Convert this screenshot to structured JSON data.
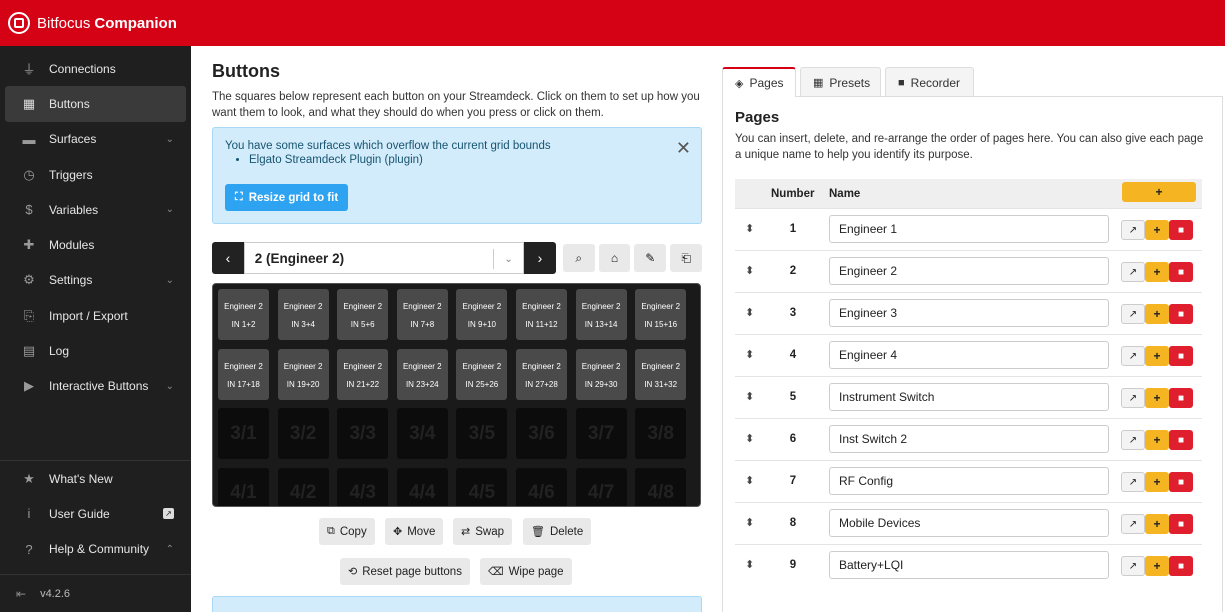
{
  "app": {
    "brand_plain": "Bitfocus",
    "brand_bold": "Companion",
    "version": "v4.2.6"
  },
  "colors": {
    "brand_red": "#d50215",
    "sidebar_bg": "#1f1f1f",
    "accent_blue": "#2ea3f2",
    "add_yellow": "#f5b523",
    "delete_red": "#e01f2e"
  },
  "sidebar": {
    "items": [
      {
        "label": "Connections",
        "icon": "plug-icon"
      },
      {
        "label": "Buttons",
        "icon": "grid-icon"
      },
      {
        "label": "Surfaces",
        "icon": "gamepad-icon"
      },
      {
        "label": "Triggers",
        "icon": "clock-icon"
      },
      {
        "label": "Variables",
        "icon": "dollar-icon"
      },
      {
        "label": "Modules",
        "icon": "puzzle-icon"
      },
      {
        "label": "Settings",
        "icon": "gear-icon"
      },
      {
        "label": "Import / Export",
        "icon": "file-import-icon"
      },
      {
        "label": "Log",
        "icon": "clipboard-icon"
      },
      {
        "label": "Interactive Buttons",
        "icon": "play-square-icon"
      }
    ],
    "bottom": [
      {
        "label": "What's New",
        "icon": "star-icon"
      },
      {
        "label": "User Guide",
        "icon": "info-icon"
      },
      {
        "label": "Help & Community",
        "icon": "question-icon"
      }
    ]
  },
  "buttons_page": {
    "title": "Buttons",
    "lead": "The squares below represent each button on your Streamdeck. Click on them to set up how you want them to look, and what they should do when you press or click on them.",
    "alert_text": "You have some surfaces which overflow the current grid bounds",
    "alert_item": "Elgato Streamdeck Plugin (plugin)",
    "resize_label": "Resize grid to fit",
    "page_select": "2 (Engineer 2)",
    "used_buttons": [
      {
        "line1": "Engineer 2",
        "line2": "IN 1+2"
      },
      {
        "line1": "Engineer 2",
        "line2": "IN 3+4"
      },
      {
        "line1": "Engineer 2",
        "line2": "IN 5+6"
      },
      {
        "line1": "Engineer 2",
        "line2": "IN 7+8"
      },
      {
        "line1": "Engineer 2",
        "line2": "IN 9+10"
      },
      {
        "line1": "Engineer 2",
        "line2": "IN 11+12"
      },
      {
        "line1": "Engineer 2",
        "line2": "IN 13+14"
      },
      {
        "line1": "Engineer 2",
        "line2": "IN 15+16"
      },
      {
        "line1": "Engineer 2",
        "line2": "IN 17+18"
      },
      {
        "line1": "Engineer 2",
        "line2": "IN 19+20"
      },
      {
        "line1": "Engineer 2",
        "line2": "IN 21+22"
      },
      {
        "line1": "Engineer 2",
        "line2": "IN 23+24"
      },
      {
        "line1": "Engineer 2",
        "line2": "IN 25+26"
      },
      {
        "line1": "Engineer 2",
        "line2": "IN 27+28"
      },
      {
        "line1": "Engineer 2",
        "line2": "IN 29+30"
      },
      {
        "line1": "Engineer 2",
        "line2": "IN 31+32"
      }
    ],
    "empty_buttons": [
      "3/1",
      "3/2",
      "3/3",
      "3/4",
      "3/5",
      "3/6",
      "3/7",
      "3/8",
      "4/1",
      "4/2",
      "4/3",
      "4/4",
      "4/5",
      "4/6",
      "4/7",
      "4/8"
    ],
    "actions": {
      "copy": "Copy",
      "move": "Move",
      "swap": "Swap",
      "delete": "Delete",
      "reset": "Reset page buttons",
      "wipe": "Wipe page"
    }
  },
  "right_panel": {
    "tabs": [
      "Pages",
      "Presets",
      "Recorder"
    ],
    "title": "Pages",
    "desc": "You can insert, delete, and re-arrange the order of pages here. You can also give each page a unique name to help you identify its purpose.",
    "col_number": "Number",
    "col_name": "Name",
    "add_label": "+",
    "pages": [
      {
        "number": "1",
        "name": "Engineer 1"
      },
      {
        "number": "2",
        "name": "Engineer 2"
      },
      {
        "number": "3",
        "name": "Engineer 3"
      },
      {
        "number": "4",
        "name": "Engineer 4"
      },
      {
        "number": "5",
        "name": "Instrument Switch"
      },
      {
        "number": "6",
        "name": "Inst Switch 2"
      },
      {
        "number": "7",
        "name": "RF Config"
      },
      {
        "number": "8",
        "name": "Mobile Devices"
      },
      {
        "number": "9",
        "name": "Battery+LQI"
      }
    ]
  }
}
